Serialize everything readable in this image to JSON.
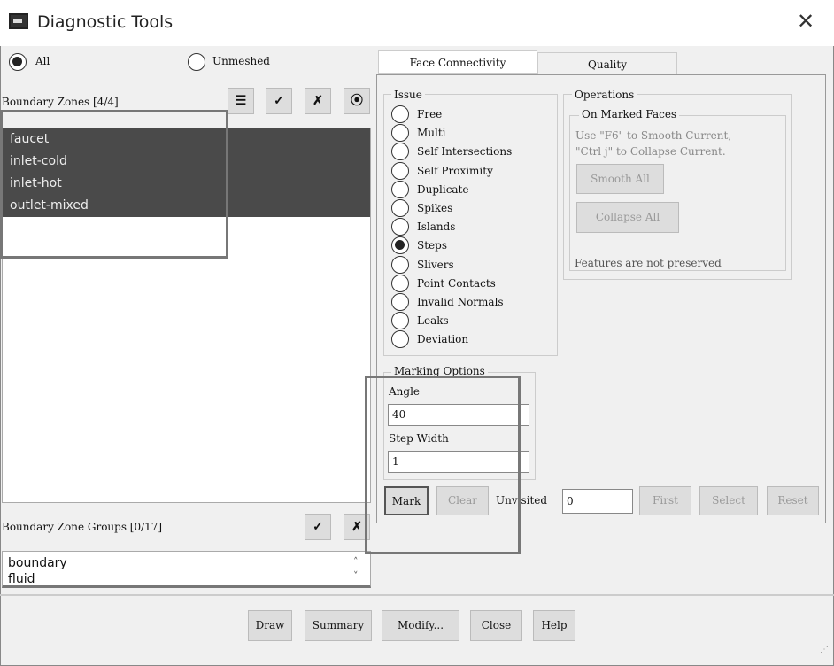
{
  "window": {
    "title": "Diagnostic Tools",
    "close_icon": "close-icon"
  },
  "filter": {
    "all": "All",
    "unmeshed": "Unmeshed",
    "selected": "All"
  },
  "boundary_zones": {
    "label": "Boundary Zones [4/4]",
    "items": [
      "faucet",
      "inlet-cold",
      "inlet-hot",
      "outlet-mixed"
    ]
  },
  "zone_groups": {
    "label": "Boundary Zone Groups [0/17]",
    "items": [
      "boundary",
      "fluid"
    ]
  },
  "tabs": [
    "Face Connectivity",
    "Quality"
  ],
  "issue": {
    "title": "Issue",
    "options": [
      "Free",
      "Multi",
      "Self Intersections",
      "Self Proximity",
      "Duplicate",
      "Spikes",
      "Islands",
      "Steps",
      "Slivers",
      "Point Contacts",
      "Invalid Normals",
      "Leaks",
      "Deviation"
    ],
    "selected": "Steps"
  },
  "operations": {
    "title": "Operations",
    "sub": "On Marked Faces",
    "hint1": "Use \"F6\" to Smooth Current,",
    "hint2": "\"Ctrl j\" to Collapse Current.",
    "smooth": "Smooth All",
    "collapse": "Collapse All",
    "note": "Features are not preserved"
  },
  "marking": {
    "title": "Marking Options",
    "angle_label": "Angle",
    "angle": "40",
    "step_label": "Step Width",
    "step": "1"
  },
  "actions": {
    "mark": "Mark",
    "clear": "Clear",
    "unvisited_label": "Unvisited",
    "unvisited": "0",
    "first": "First",
    "select": "Select",
    "reset": "Reset"
  },
  "footer": {
    "draw": "Draw",
    "summary": "Summary",
    "modify": "Modify...",
    "close": "Close",
    "help": "Help"
  }
}
